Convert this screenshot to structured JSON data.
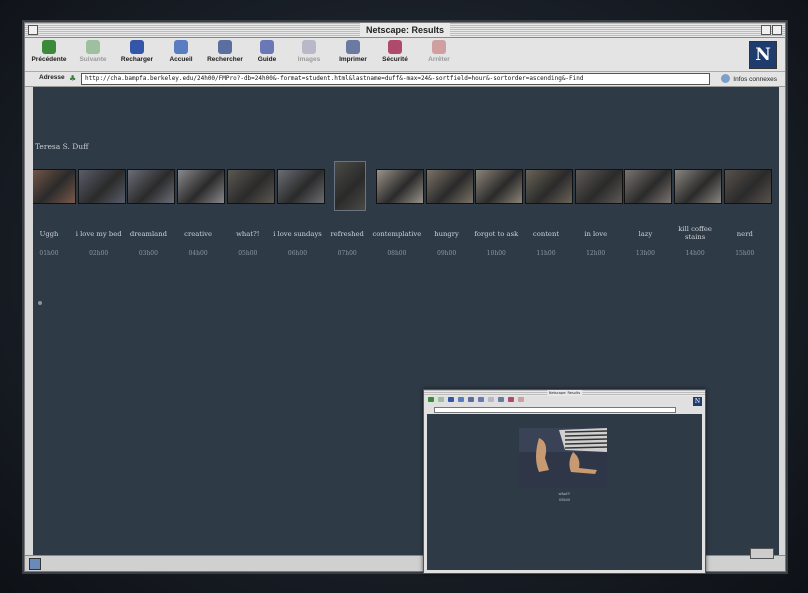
{
  "window": {
    "title": "Netscape: Results"
  },
  "toolbar": {
    "buttons": [
      {
        "label": "Précédente",
        "icon": "back-arrow-icon",
        "enabled": true,
        "color": "#3b8a3b"
      },
      {
        "label": "Suivante",
        "icon": "forward-arrow-icon",
        "enabled": false,
        "color": "#9fc09f"
      },
      {
        "label": "Recharger",
        "icon": "reload-icon",
        "enabled": true,
        "color": "#3356a8"
      },
      {
        "label": "Accueil",
        "icon": "home-icon",
        "enabled": true,
        "color": "#5a7cc0"
      },
      {
        "label": "Rechercher",
        "icon": "search-icon",
        "enabled": true,
        "color": "#5a6fa0"
      },
      {
        "label": "Guide",
        "icon": "guide-icon",
        "enabled": true,
        "color": "#6a78b8"
      },
      {
        "label": "Images",
        "icon": "images-icon",
        "enabled": false,
        "color": "#b8b8c8"
      },
      {
        "label": "Imprimer",
        "icon": "print-icon",
        "enabled": true,
        "color": "#6a7aa0"
      },
      {
        "label": "Sécurité",
        "icon": "lock-icon",
        "enabled": true,
        "color": "#b04a6a"
      },
      {
        "label": "Arrêter",
        "icon": "stop-icon",
        "enabled": false,
        "color": "#d0a0a0"
      }
    ],
    "logo_letter": "N"
  },
  "location": {
    "label": "Adresse",
    "url": "http://cha.bampfa.berkeley.edu/24h00/FMPro?-db=24h00&-format=student.html&lastname=duff&-max=24&-sortfield=hour&-sortorder=ascending&-Find",
    "info_label": "Infos connexes"
  },
  "page": {
    "author": "Teresa S. Duff",
    "entries": [
      {
        "label": "Uggh",
        "time": "01h00",
        "tint": "#7a5a4a"
      },
      {
        "label": "i love my bed",
        "time": "02h00",
        "tint": "#5a5e6a"
      },
      {
        "label": "dreamland",
        "time": "03h00",
        "tint": "#6a6e78"
      },
      {
        "label": "creative",
        "time": "04h00",
        "tint": "#8a8a8e"
      },
      {
        "label": "what?!",
        "time": "05h00",
        "tint": "#5a5850"
      },
      {
        "label": "i love sundays",
        "time": "06h00",
        "tint": "#6c6e74"
      },
      {
        "label": "refreshed",
        "time": "07h00",
        "tint": "#4a4a46"
      },
      {
        "label": "contemplative",
        "time": "08h00",
        "tint": "#9a948a"
      },
      {
        "label": "hungry",
        "time": "09h00",
        "tint": "#7a7266"
      },
      {
        "label": "forgot to ask",
        "time": "10h00",
        "tint": "#8c8478"
      },
      {
        "label": "content",
        "time": "11h00",
        "tint": "#6a6458"
      },
      {
        "label": "in love",
        "time": "12h00",
        "tint": "#5e5a56"
      },
      {
        "label": "lazy",
        "time": "13h00",
        "tint": "#7a7470"
      },
      {
        "label": "kill coffee stains",
        "time": "14h00",
        "tint": "#8a8680"
      },
      {
        "label": "nerd",
        "time": "15h00",
        "tint": "#58524c"
      }
    ]
  },
  "popup": {
    "title": "Netscape: Results",
    "caption": "what?!",
    "time": "05h00"
  }
}
